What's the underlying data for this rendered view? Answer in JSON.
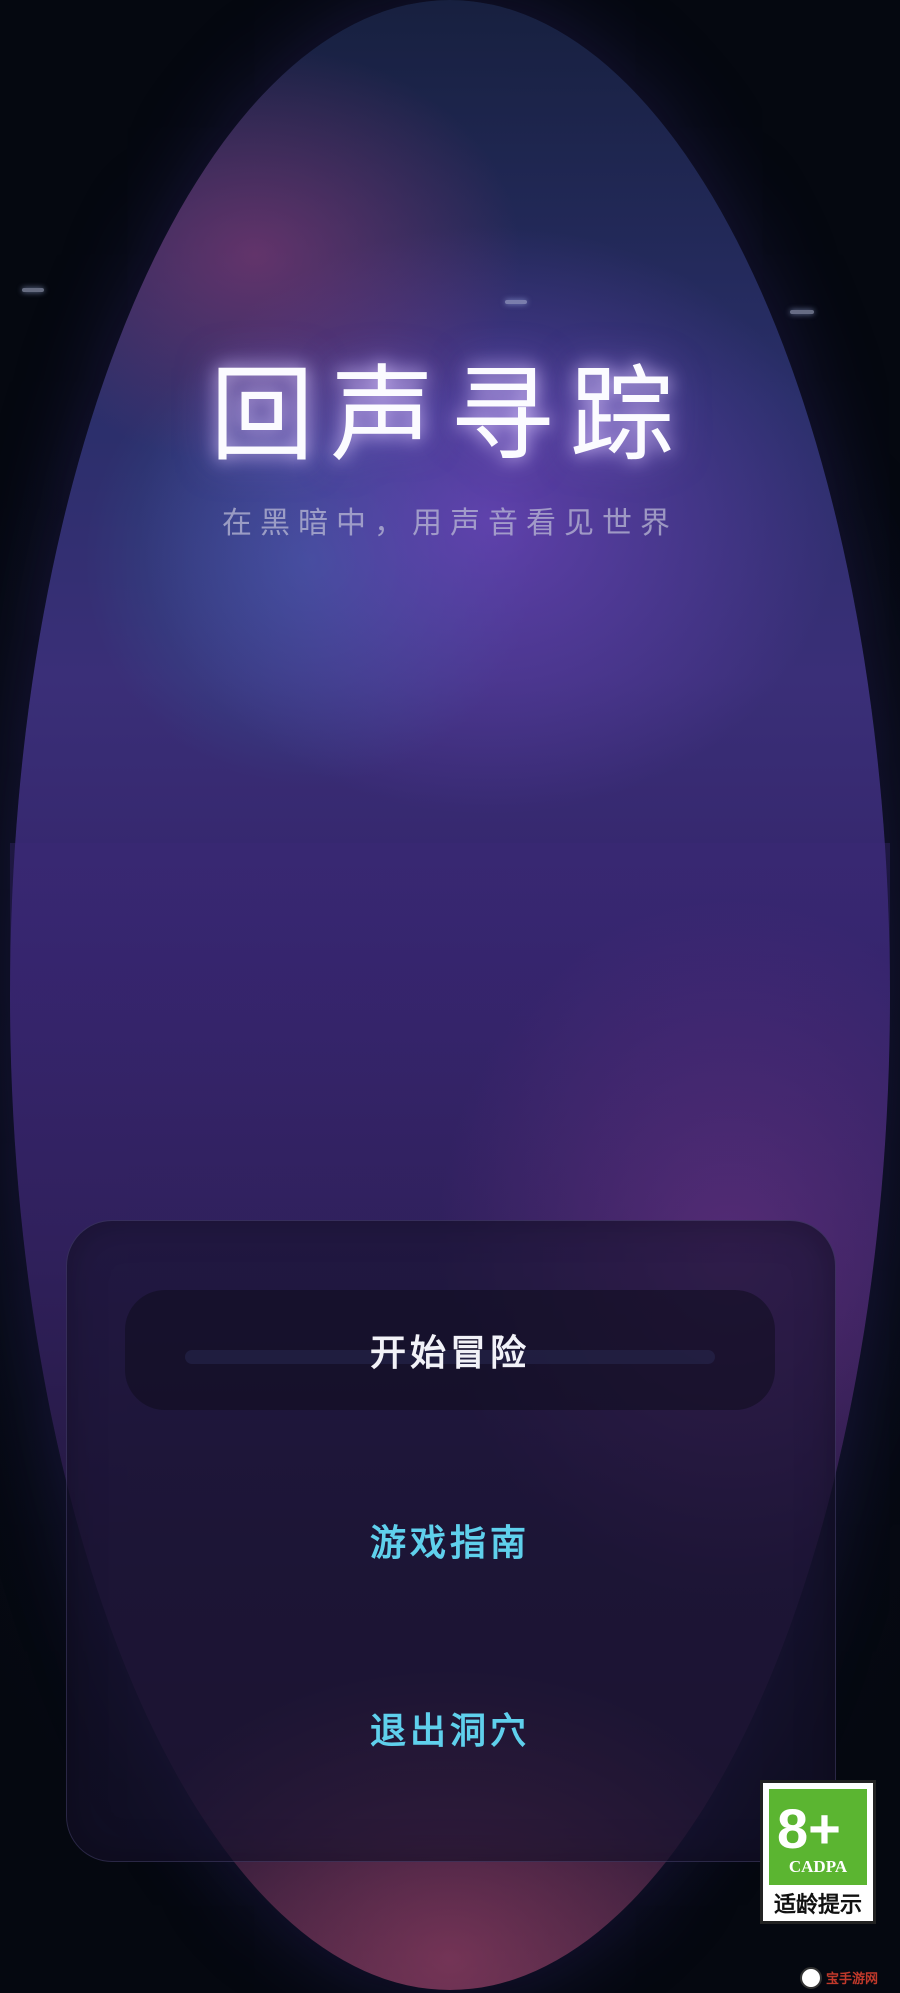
{
  "game": {
    "title": "回声寻踪",
    "subtitle": "在黑暗中，用声音看见世界"
  },
  "menu": {
    "start_label": "开始冒险",
    "guide_label": "游戏指南",
    "exit_label": "退出洞穴"
  },
  "age_rating": {
    "age": "8+",
    "org": "CADPA",
    "tip": "适龄提示"
  },
  "watermark": {
    "text": "宝手游网",
    "icon": "panda-logo-icon"
  },
  "colors": {
    "title_glow": "#dcc8ff",
    "menu_accent": "#5fd0ec",
    "rating_green": "#5bb531"
  }
}
